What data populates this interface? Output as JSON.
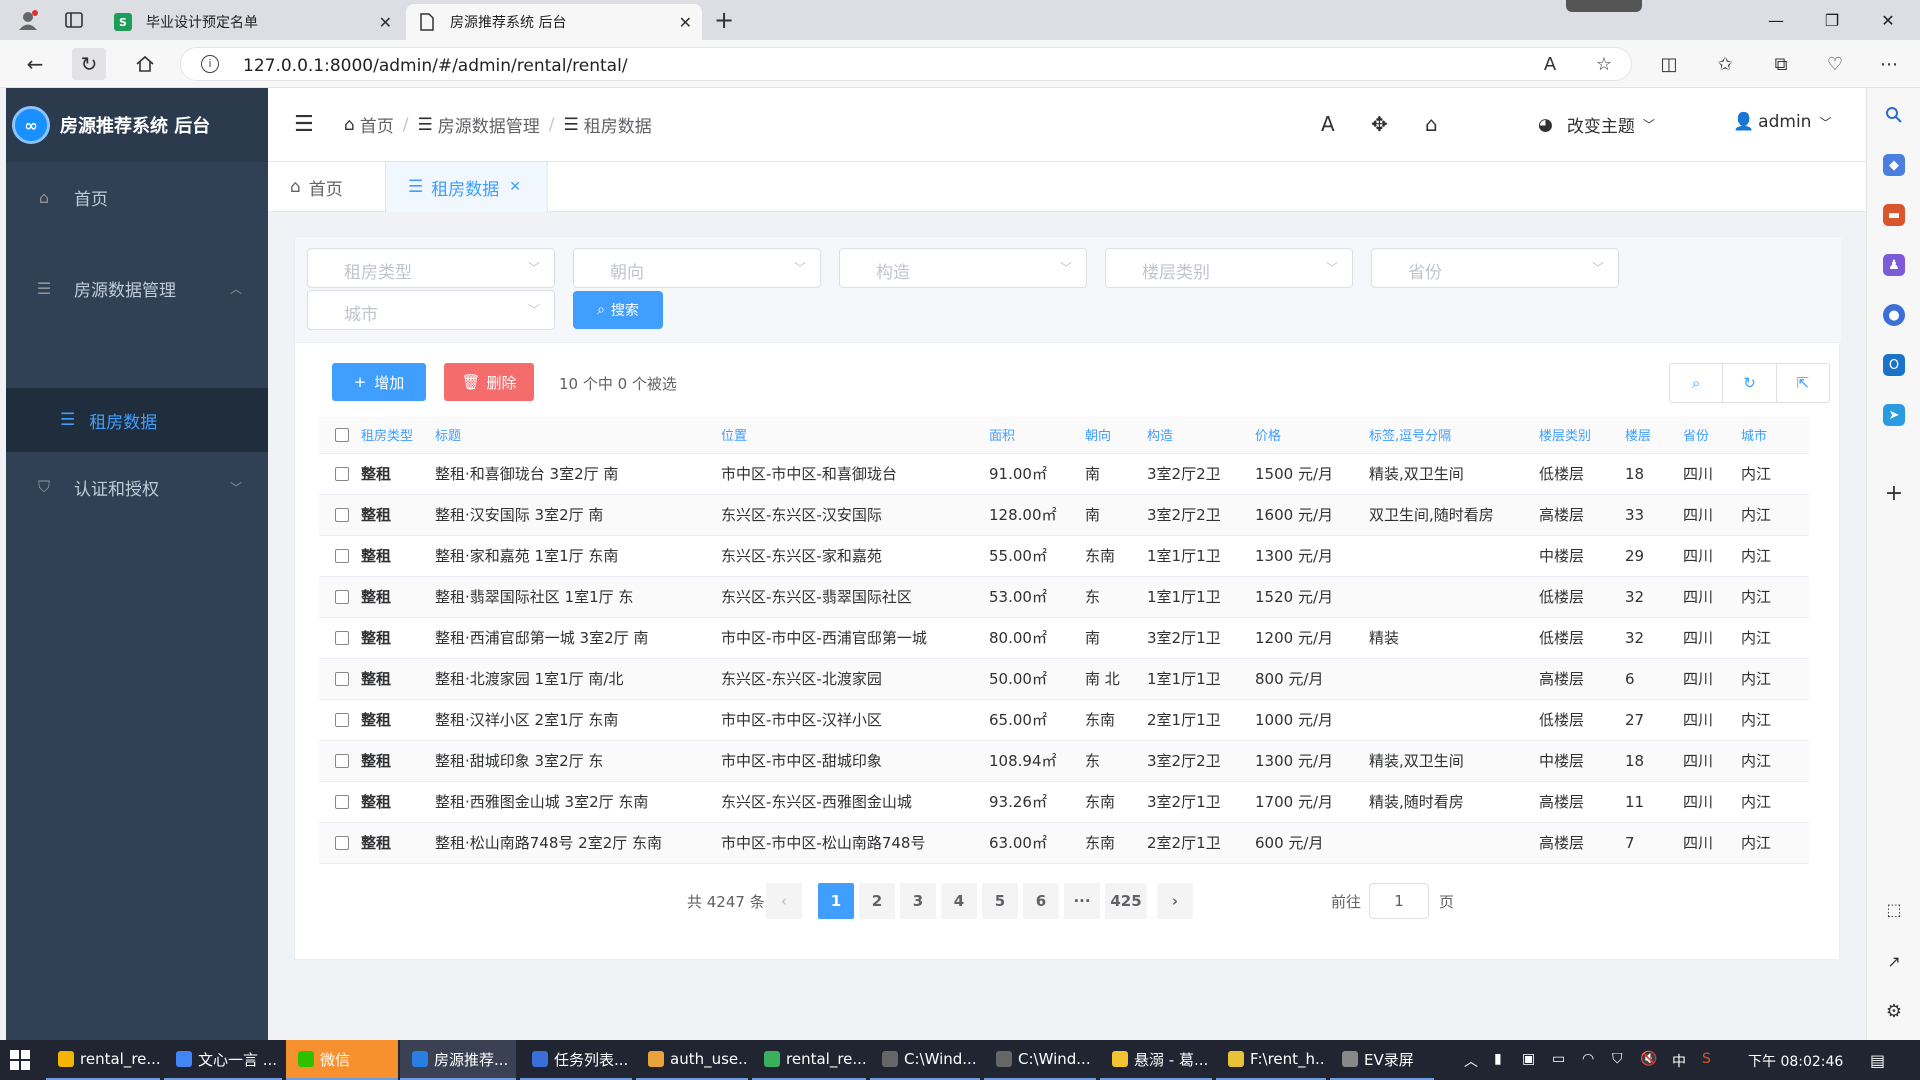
{
  "browser": {
    "tabs": [
      {
        "title": "毕业设计预定名单",
        "favicon": "S"
      },
      {
        "title": "房源推荐系统 后台"
      }
    ],
    "url": "127.0.0.1:8000/admin/#/admin/rental/rental/"
  },
  "app": {
    "title": "房源推荐系统 后台",
    "logo_glyph": "∞"
  },
  "sidebar": {
    "items": [
      {
        "label": "首页"
      },
      {
        "label": "房源数据管理"
      },
      {
        "label": "租房数据"
      },
      {
        "label": "认证和授权"
      }
    ]
  },
  "header": {
    "breadcrumb": [
      "首页",
      "房源数据管理",
      "租房数据"
    ],
    "theme_label": "改变主题",
    "user": "admin"
  },
  "tags": [
    {
      "label": "首页"
    },
    {
      "label": "租房数据"
    }
  ],
  "filters": {
    "placeholders": [
      "租房类型",
      "朝向",
      "构造",
      "楼层类别",
      "省份",
      "城市"
    ],
    "search_label": "搜索"
  },
  "toolbar": {
    "add_label": "增加",
    "delete_label": "删除",
    "selection_info": "10 个中 0 个被选"
  },
  "table": {
    "columns": [
      "租房类型",
      "标题",
      "位置",
      "面积",
      "朝向",
      "构造",
      "价格",
      "标签,逗号分隔",
      "楼层类别",
      "楼层",
      "省份",
      "城市"
    ],
    "rows": [
      [
        "整租",
        "整租·和喜御珑台 3室2厅 南",
        "市中区-市中区-和喜御珑台",
        "91.00㎡",
        "南",
        "3室2厅2卫",
        "1500 元/月",
        "精装,双卫生间",
        "低楼层",
        "18",
        "四川",
        "内江"
      ],
      [
        "整租",
        "整租·汉安国际 3室2厅 南",
        "东兴区-东兴区-汉安国际",
        "128.00㎡",
        "南",
        "3室2厅2卫",
        "1600 元/月",
        "双卫生间,随时看房",
        "高楼层",
        "33",
        "四川",
        "内江"
      ],
      [
        "整租",
        "整租·家和嘉苑 1室1厅 东南",
        "东兴区-东兴区-家和嘉苑",
        "55.00㎡",
        "东南",
        "1室1厅1卫",
        "1300 元/月",
        "",
        "中楼层",
        "29",
        "四川",
        "内江"
      ],
      [
        "整租",
        "整租·翡翠国际社区 1室1厅 东",
        "东兴区-东兴区-翡翠国际社区",
        "53.00㎡",
        "东",
        "1室1厅1卫",
        "1520 元/月",
        "",
        "低楼层",
        "32",
        "四川",
        "内江"
      ],
      [
        "整租",
        "整租·西浦官邸第一城 3室2厅 南",
        "市中区-市中区-西浦官邸第一城",
        "80.00㎡",
        "南",
        "3室2厅1卫",
        "1200 元/月",
        "精装",
        "低楼层",
        "32",
        "四川",
        "内江"
      ],
      [
        "整租",
        "整租·北渡家园 1室1厅 南/北",
        "东兴区-东兴区-北渡家园",
        "50.00㎡",
        "南 北",
        "1室1厅1卫",
        "800 元/月",
        "",
        "高楼层",
        "6",
        "四川",
        "内江"
      ],
      [
        "整租",
        "整租·汉祥小区 2室1厅 东南",
        "市中区-市中区-汉祥小区",
        "65.00㎡",
        "东南",
        "2室1厅1卫",
        "1000 元/月",
        "",
        "低楼层",
        "27",
        "四川",
        "内江"
      ],
      [
        "整租",
        "整租·甜城印象 3室2厅 东",
        "市中区-市中区-甜城印象",
        "108.94㎡",
        "东",
        "3室2厅2卫",
        "1300 元/月",
        "精装,双卫生间",
        "中楼层",
        "18",
        "四川",
        "内江"
      ],
      [
        "整租",
        "整租·西雅图金山城 3室2厅 东南",
        "东兴区-东兴区-西雅图金山城",
        "93.26㎡",
        "东南",
        "3室2厅1卫",
        "1700 元/月",
        "精装,随时看房",
        "高楼层",
        "11",
        "四川",
        "内江"
      ],
      [
        "整租",
        "整租·松山南路748号 2室2厅 东南",
        "市中区-市中区-松山南路748号",
        "63.00㎡",
        "东南",
        "2室2厅1卫",
        "600 元/月",
        "",
        "高楼层",
        "7",
        "四川",
        "内江"
      ]
    ]
  },
  "pagination": {
    "total": "共 4247 条",
    "pages": [
      "1",
      "2",
      "3",
      "4",
      "5",
      "6",
      "···",
      "425"
    ],
    "current": "1",
    "goto_prefix": "前往",
    "goto_value": "1",
    "goto_suffix": "页"
  },
  "taskbar": {
    "items": [
      "rental_re...",
      "文心一言 ...",
      "微信",
      "房源推荐...",
      "任务列表...",
      "auth_use...",
      "rental_re...",
      "C:\\Wind...",
      "C:\\Wind...",
      "悬溺 - 葛...",
      "F:\\rent_h...",
      "EV录屏"
    ],
    "time": "下午 08:02:46",
    "ime": "中"
  },
  "colors": {
    "primary": "#409eff",
    "danger": "#f56c6c",
    "sidebar_bg": "#304156"
  }
}
